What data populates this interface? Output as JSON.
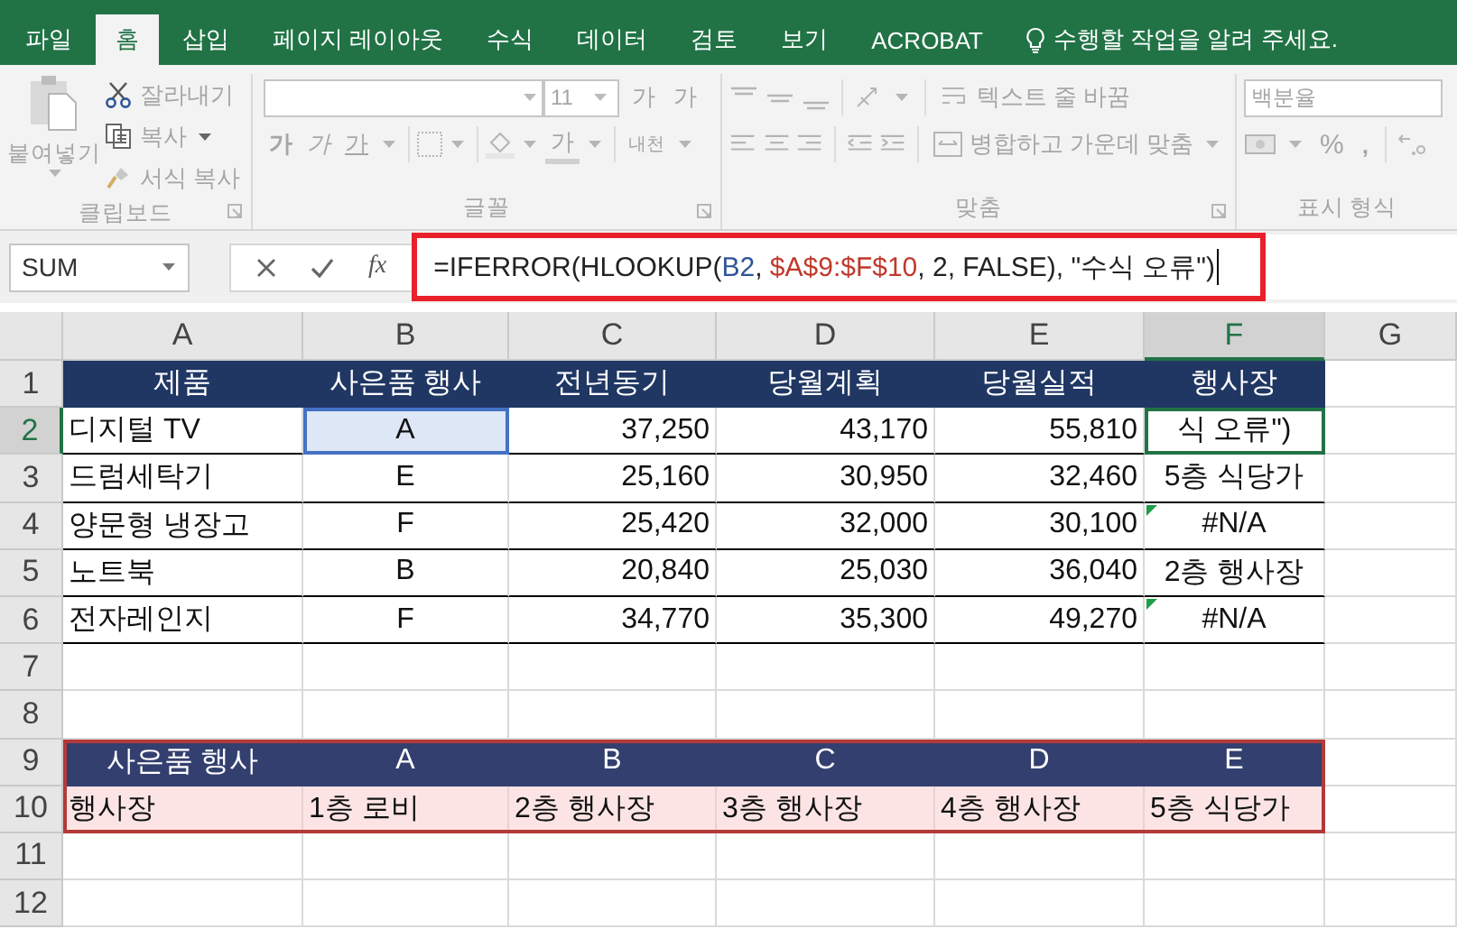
{
  "tabs": [
    {
      "label": "파일",
      "selected": false
    },
    {
      "label": "홈",
      "selected": true
    },
    {
      "label": "삽입",
      "selected": false
    },
    {
      "label": "페이지 레이아웃",
      "selected": false
    },
    {
      "label": "수식",
      "selected": false
    },
    {
      "label": "데이터",
      "selected": false
    },
    {
      "label": "검토",
      "selected": false
    },
    {
      "label": "보기",
      "selected": false
    },
    {
      "label": "ACROBAT",
      "selected": false
    }
  ],
  "tell_me": "수행할 작업을 알려 주세요.",
  "ribbon": {
    "disabled": true,
    "clipboard": {
      "paste": "붙여넣기",
      "cut": "잘라내기",
      "copy": "복사",
      "format_painter": "서식 복사",
      "label": "클립보드"
    },
    "font": {
      "size": "11",
      "grow": "가",
      "shrink": "가",
      "bold": "가",
      "italic": "가",
      "underline": "가",
      "font_color": "가",
      "phonetic": "내천",
      "label": "글꼴"
    },
    "alignment": {
      "wrap_text": "텍스트 줄 바꿈",
      "merge_center": "병합하고 가운데 맞춤",
      "label": "맞춤"
    },
    "number": {
      "format": "백분율",
      "percent": "%",
      "comma": ",",
      "label": "표시 형식"
    }
  },
  "name_box": "SUM",
  "fx": "fx",
  "formula": {
    "highlighted": true,
    "parts": [
      {
        "text": "=IFERROR(HLOOKUP("
      },
      {
        "text": "B2",
        "color": "#2f5597"
      },
      {
        "text": ", "
      },
      {
        "text": "$A$9:$F$10",
        "color": "#c0392b"
      },
      {
        "text": ", 2, FALSE), \"수식 오류\")"
      }
    ]
  },
  "columns": [
    {
      "label": "A",
      "selected": false
    },
    {
      "label": "B",
      "selected": false
    },
    {
      "label": "C",
      "selected": false
    },
    {
      "label": "D",
      "selected": false
    },
    {
      "label": "E",
      "selected": false
    },
    {
      "label": "F",
      "selected": true
    },
    {
      "label": "G",
      "selected": false
    }
  ],
  "rows": [
    {
      "number": "1",
      "selected": false,
      "kind": "header",
      "cells": [
        {
          "text": "제품"
        },
        {
          "text": "사은품 행사"
        },
        {
          "text": "전년동기"
        },
        {
          "text": "당월계획"
        },
        {
          "text": "당월실적"
        },
        {
          "text": "행사장"
        }
      ]
    },
    {
      "number": "2",
      "selected": true,
      "kind": "data",
      "cells": [
        {
          "text": "디지털 TV"
        },
        {
          "text": "A",
          "referenced": true
        },
        {
          "text": "37,250"
        },
        {
          "text": "43,170"
        },
        {
          "text": "55,810"
        },
        {
          "text": "식 오류\")",
          "active": true
        }
      ]
    },
    {
      "number": "3",
      "selected": false,
      "kind": "data",
      "cells": [
        {
          "text": "드럼세탁기"
        },
        {
          "text": "E"
        },
        {
          "text": "25,160"
        },
        {
          "text": "30,950"
        },
        {
          "text": "32,460"
        },
        {
          "text": "5층 식당가"
        }
      ]
    },
    {
      "number": "4",
      "selected": false,
      "kind": "data",
      "cells": [
        {
          "text": "양문형 냉장고"
        },
        {
          "text": "F"
        },
        {
          "text": "25,420"
        },
        {
          "text": "32,000"
        },
        {
          "text": "30,100"
        },
        {
          "text": "#N/A",
          "error_flag": true
        }
      ]
    },
    {
      "number": "5",
      "selected": false,
      "kind": "data",
      "cells": [
        {
          "text": "노트북"
        },
        {
          "text": "B"
        },
        {
          "text": "20,840"
        },
        {
          "text": "25,030"
        },
        {
          "text": "36,040"
        },
        {
          "text": "2층 행사장"
        }
      ]
    },
    {
      "number": "6",
      "selected": false,
      "kind": "data",
      "cells": [
        {
          "text": "전자레인지"
        },
        {
          "text": "F"
        },
        {
          "text": "34,770"
        },
        {
          "text": "35,300"
        },
        {
          "text": "49,270"
        },
        {
          "text": "#N/A",
          "error_flag": true
        }
      ]
    },
    {
      "number": "7",
      "selected": false
    },
    {
      "number": "8",
      "selected": false
    },
    {
      "number": "9",
      "selected": false,
      "kind": "band_header",
      "referenced": true,
      "cells": [
        {
          "text": "사은품 행사"
        },
        {
          "text": "A"
        },
        {
          "text": "B"
        },
        {
          "text": "C"
        },
        {
          "text": "D"
        },
        {
          "text": "E"
        }
      ]
    },
    {
      "number": "10",
      "selected": false,
      "kind": "band",
      "referenced": true,
      "cells": [
        {
          "text": "행사장"
        },
        {
          "text": "1층 로비"
        },
        {
          "text": "2층 행사장"
        },
        {
          "text": "3층 행사장"
        },
        {
          "text": "4층 행사장"
        },
        {
          "text": "5층 식당가"
        }
      ]
    },
    {
      "number": "11",
      "selected": false
    },
    {
      "number": "12",
      "selected": false
    }
  ]
}
